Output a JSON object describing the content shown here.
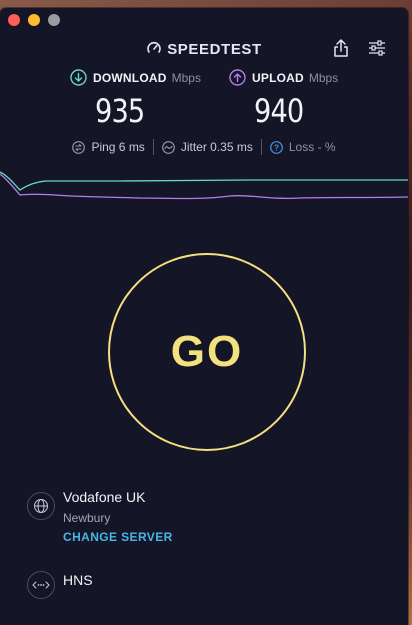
{
  "window": {
    "traffic_lights": [
      "close",
      "minimize",
      "zoom"
    ]
  },
  "header": {
    "logo_text": "SPEEDTEST",
    "share_icon": "share-icon",
    "settings_icon": "sliders-icon"
  },
  "download": {
    "label": "DOWNLOAD",
    "unit": "Mbps",
    "value": "935",
    "icon": "download-arrow-icon",
    "color": "#67d8c8"
  },
  "upload": {
    "label": "UPLOAD",
    "unit": "Mbps",
    "value": "940",
    "icon": "upload-arrow-icon",
    "color": "#b57ee8"
  },
  "stats": {
    "ping": "Ping 6 ms",
    "jitter": "Jitter 0.35 ms",
    "loss": "Loss - %"
  },
  "go_button": {
    "label": "GO",
    "color": "#f4e07d"
  },
  "server": {
    "provider": "Vodafone UK",
    "location": "Newbury",
    "change_label": "CHANGE SERVER",
    "icon": "globe-icon"
  },
  "isp": {
    "name": "HNS",
    "icon": "connection-icon"
  }
}
